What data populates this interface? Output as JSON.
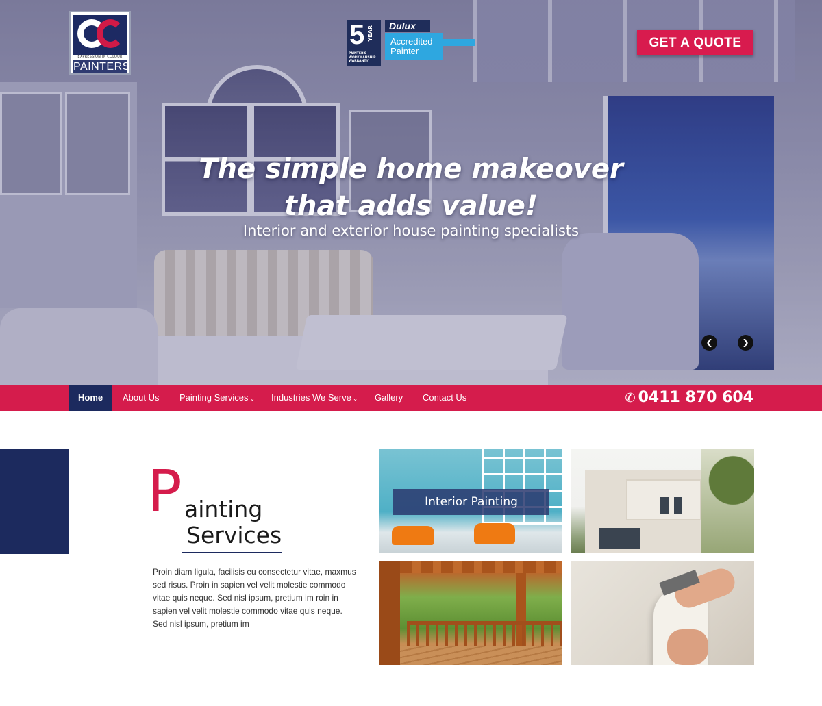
{
  "header": {
    "logo": {
      "mark": "ec",
      "tagline": "EXPRESSION IN COLOUR",
      "word": "PAINTERS"
    },
    "badge": {
      "years": "5",
      "year_word": "YEAR",
      "warranty": "PAINTER'S WORKMANSHIP WARRANTY",
      "brand": "Dulux",
      "accredited": "Accredited Painter"
    },
    "quote_button": "GET A QUOTE"
  },
  "hero": {
    "headline_line1": "The simple home makeover",
    "headline_line2": "that adds value!",
    "subheadline": "Interior and exterior house painting specialists",
    "prev_icon": "chevron-left-icon",
    "next_icon": "chevron-right-icon"
  },
  "nav": {
    "items": [
      {
        "label": "Home",
        "active": true
      },
      {
        "label": "About Us"
      },
      {
        "label": "Painting Services",
        "dropdown": true
      },
      {
        "label": "Industries We Serve",
        "dropdown": true
      },
      {
        "label": "Gallery"
      },
      {
        "label": "Contact Us"
      }
    ],
    "phone": "0411 870 604",
    "phone_icon": "phone-icon"
  },
  "services": {
    "heading_initial": "P",
    "heading_line1": "ainting",
    "heading_line2": "Services",
    "body": "Proin diam ligula, facilisis eu consectetur vitae, maxmus sed risus. Proin in sapien vel velit molestie commodo vitae quis neque. Sed nisl ipsum, pretium im roin in sapien vel velit molestie commodo vitae quis neque. Sed nisl ipsum, pretium im",
    "tiles": [
      {
        "label": "Interior Painting"
      }
    ]
  },
  "colors": {
    "accent": "#d51c4c",
    "navy": "#1c2a5e",
    "dulux_blue": "#2ea7e0"
  }
}
